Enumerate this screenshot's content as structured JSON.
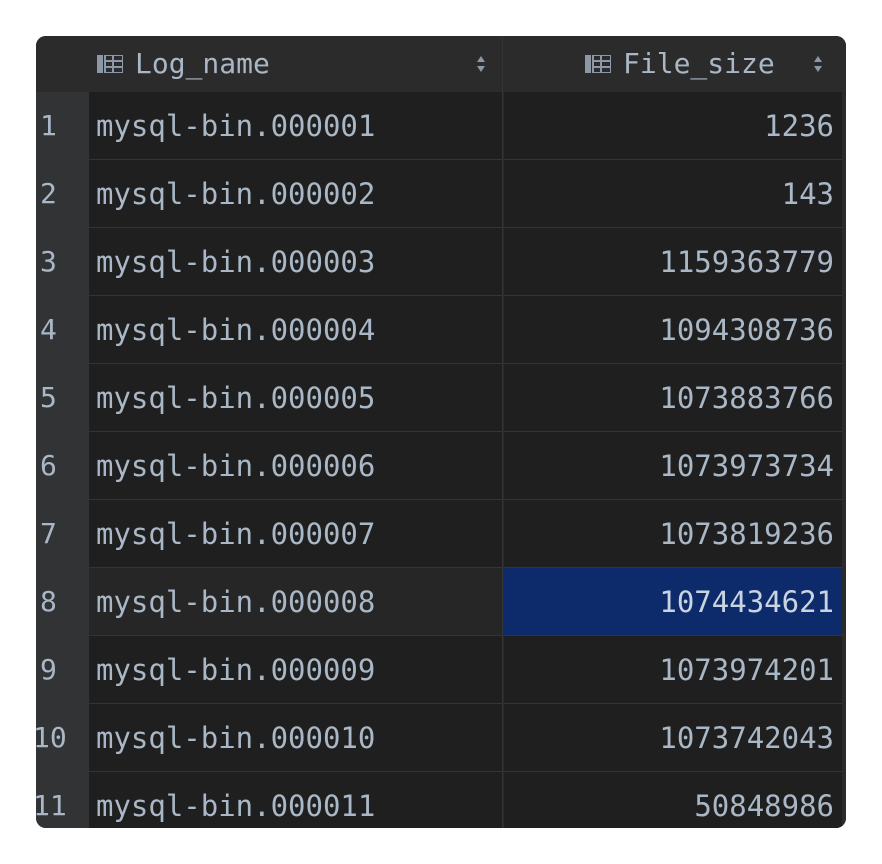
{
  "table": {
    "columns": [
      {
        "label": "Log_name",
        "icon": "column-icon",
        "sort_icon": "sort-updown-icon"
      },
      {
        "label": "File_size",
        "icon": "column-icon",
        "sort_icon": "sort-updown-icon"
      }
    ],
    "rows": [
      {
        "num": "1",
        "log_name": "mysql-bin.000001",
        "file_size": "1236"
      },
      {
        "num": "2",
        "log_name": "mysql-bin.000002",
        "file_size": "143"
      },
      {
        "num": "3",
        "log_name": "mysql-bin.000003",
        "file_size": "1159363779"
      },
      {
        "num": "4",
        "log_name": "mysql-bin.000004",
        "file_size": "1094308736"
      },
      {
        "num": "5",
        "log_name": "mysql-bin.000005",
        "file_size": "1073883766"
      },
      {
        "num": "6",
        "log_name": "mysql-bin.000006",
        "file_size": "1073973734"
      },
      {
        "num": "7",
        "log_name": "mysql-bin.000007",
        "file_size": "1073819236"
      },
      {
        "num": "8",
        "log_name": "mysql-bin.000008",
        "file_size": "1074434621"
      },
      {
        "num": "9",
        "log_name": "mysql-bin.000009",
        "file_size": "1073974201"
      },
      {
        "num": "10",
        "log_name": "mysql-bin.000010",
        "file_size": "1073742043"
      },
      {
        "num": "11",
        "log_name": "mysql-bin.000011",
        "file_size": "50848986"
      }
    ],
    "selected_row": 8,
    "selected_column": "File_size"
  },
  "colors": {
    "background": "#2b2b2b",
    "cell_background": "#1f1f1f",
    "text": "#a9b7c6",
    "selection": "#0d2a6b"
  }
}
